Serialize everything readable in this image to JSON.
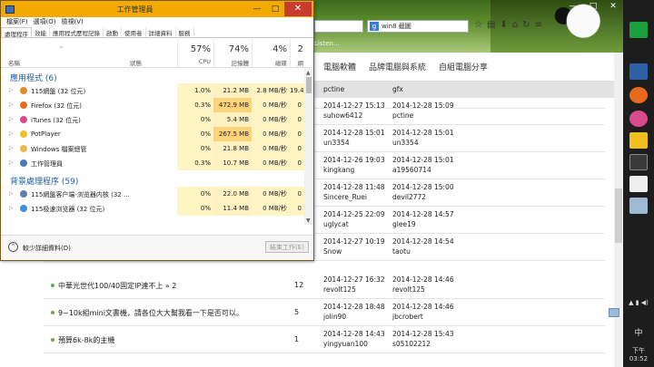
{
  "browser": {
    "search_query": "win8 截圖",
    "toolbar_partial": "Listen...",
    "nav_tabs": [
      "電腦軟體",
      "品牌電腦與系統",
      "自組電腦分享"
    ],
    "window_controls": [
      "—",
      "□",
      "✕"
    ],
    "rows": [
      {
        "title": "",
        "num": "",
        "c1a": "pctine",
        "c1b": "",
        "c2a": "gfx",
        "c2b": ""
      },
      {
        "title": "",
        "num": "",
        "c1a": "2014-12-27 15:13",
        "c1b": "suhow6412",
        "c2a": "2014-12-28 15:09",
        "c2b": "pctine"
      },
      {
        "title": "",
        "num": "",
        "c1a": "2014-12-28 15:01",
        "c1b": "un3354",
        "c2a": "2014-12-28 15:01",
        "c2b": "un3354"
      },
      {
        "title": "",
        "num": "",
        "c1a": "2014-12-26 19:03",
        "c1b": "kingkang",
        "c2a": "2014-12-28 15:01",
        "c2b": "a19560714"
      },
      {
        "title": "",
        "num": "",
        "c1a": "2014-12-28 11:48",
        "c1b": "Sincere_Ruei",
        "c2a": "2014-12-28 15:00",
        "c2b": "devil2772"
      },
      {
        "title": "",
        "num": "",
        "c1a": "2014-12-25 22:09",
        "c1b": "uglycat",
        "c2a": "2014-12-28 14:57",
        "c2b": "glee19"
      },
      {
        "title": "",
        "num": "",
        "c1a": "2014-12-27 10:19",
        "c1b": "Snow",
        "c2a": "2014-12-28 14:54",
        "c2b": "taotu"
      },
      {
        "title": "中華光世代100/40固定IP連不上 » 2",
        "num": "12",
        "c1a": "2014-12-27 16:32",
        "c1b": "revolt125",
        "c2a": "2014-12-28 14:46",
        "c2b": "revolt125"
      },
      {
        "title": "9~10k組mini文書機，請各位大大幫我看一下是否可以。",
        "num": "5",
        "c1a": "2014-12-28 18:48",
        "c1b": "jolin90",
        "c2a": "2014-12-28 14:46",
        "c2b": "jbcrobert"
      },
      {
        "title": "預算6k-8k的主機",
        "num": "1",
        "c1a": "2014-12-28 14:43",
        "c1b": "yingyuan100",
        "c2a": "2014-12-28 15:43",
        "c2b": "s05102212"
      }
    ]
  },
  "taskbar": {
    "lang": "中",
    "time": "下午 03:52"
  },
  "taskmgr": {
    "title": "工作管理員",
    "window_controls": [
      "—",
      "□",
      "✕"
    ],
    "menu": [
      "檔案(F)",
      "選項(O)",
      "檢視(V)"
    ],
    "tabs": [
      "處理程序",
      "效能",
      "應用程式歷程記錄",
      "啟動",
      "使用者",
      "詳細資料",
      "服務"
    ],
    "active_tab": 0,
    "header": {
      "name": "名稱",
      "status": "狀態",
      "cpu_pct": "57%",
      "cpu": "CPU",
      "mem_pct": "74%",
      "mem": "記憶體",
      "disk_pct": "4%",
      "disk": "磁碟",
      "net_pct": "2",
      "net": "網"
    },
    "groups": [
      {
        "label": "應用程式 (6)",
        "rows": [
          {
            "name": "115網盤 (32 位元)",
            "icon": "#e28b2b",
            "cpu": "1.0%",
            "mem": "21.2 MB",
            "disk": "2.8 MB/秒",
            "net": "19.4"
          },
          {
            "name": "Firefox (32 位元)",
            "icon": "#e66a1b",
            "cpu": "0.3%",
            "mem": "472.9 MB",
            "disk": "0 MB/秒",
            "net": "0"
          },
          {
            "name": "iTunes (32 位元)",
            "icon": "#d94a8c",
            "cpu": "0%",
            "mem": "5.4 MB",
            "disk": "0 MB/秒",
            "net": "0"
          },
          {
            "name": "PotPlayer",
            "icon": "#f0c020",
            "cpu": "0%",
            "mem": "267.5 MB",
            "disk": "0 MB/秒",
            "net": "0"
          },
          {
            "name": "Windows 檔案總管",
            "icon": "#e9b84a",
            "cpu": "0%",
            "mem": "21.8 MB",
            "disk": "0 MB/秒",
            "net": "0"
          },
          {
            "name": "工作管理員",
            "icon": "#4a78b8",
            "cpu": "0.3%",
            "mem": "10.7 MB",
            "disk": "0 MB/秒",
            "net": "0"
          }
        ]
      },
      {
        "label": "背景處理程序 (59)",
        "rows": [
          {
            "name": "115網盤客户端-浏览器内核 (32 ...",
            "icon": "#5a7fb0",
            "cpu": "0%",
            "mem": "22.0 MB",
            "disk": "0 MB/秒",
            "net": "0"
          },
          {
            "name": "115极速浏览器 (32 位元)",
            "icon": "#3b8fd6",
            "cpu": "0%",
            "mem": "11.4 MB",
            "disk": "0 MB/秒",
            "net": "0"
          }
        ]
      }
    ],
    "less_details": "較少詳細資料(D)",
    "end_task": "結束工作(E)"
  }
}
